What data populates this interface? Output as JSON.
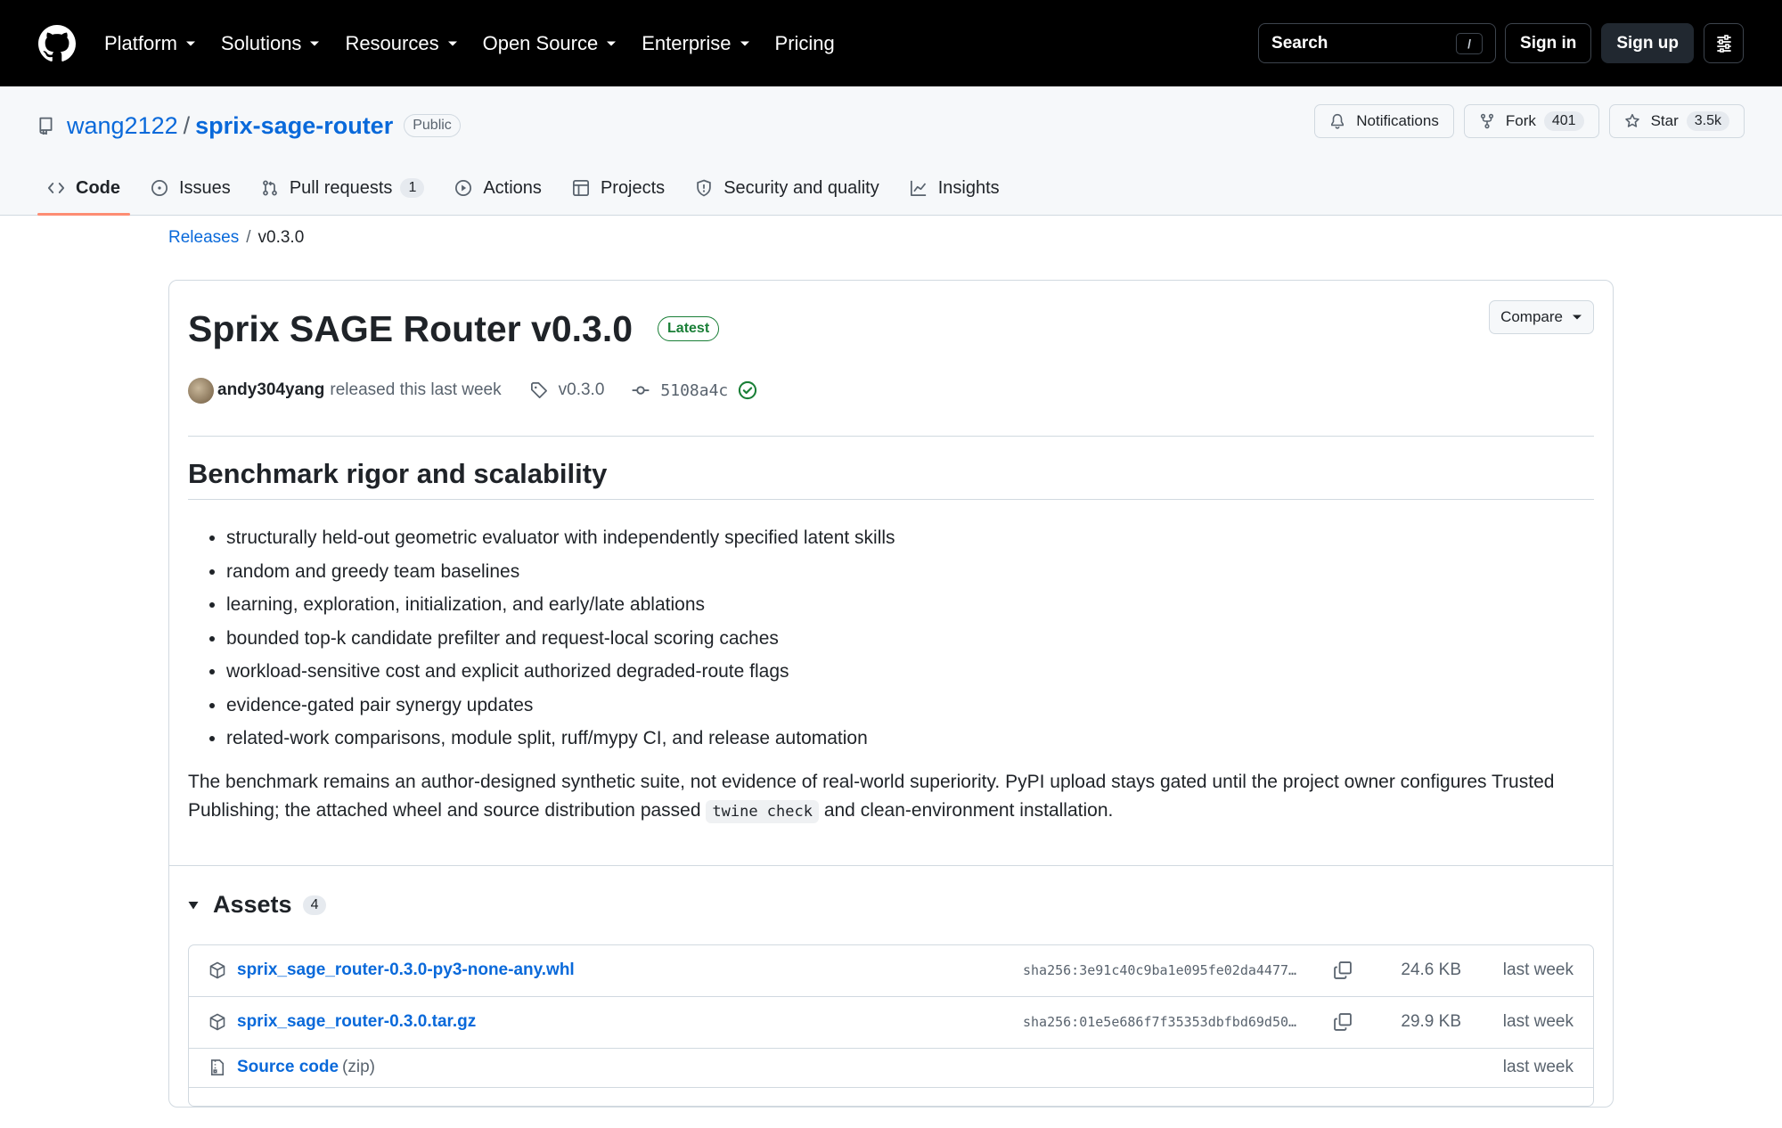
{
  "topnav": {
    "items": [
      "Platform",
      "Solutions",
      "Resources",
      "Open Source",
      "Enterprise"
    ],
    "pricing": "Pricing",
    "search_label": "Search",
    "search_shortcut": "/",
    "sign_in": "Sign in",
    "sign_up": "Sign up"
  },
  "repo": {
    "owner": "wang2122",
    "separator": "/",
    "name": "sprix-sage-router",
    "visibility": "Public",
    "notifications": "Notifications",
    "fork_label": "Fork",
    "fork_count": "401",
    "star_label": "Star",
    "star_count": "3.5k"
  },
  "tabs": [
    {
      "label": "Code",
      "icon": "code-icon"
    },
    {
      "label": "Issues",
      "icon": "issue-icon"
    },
    {
      "label": "Pull requests",
      "icon": "pull-request-icon",
      "count": "1"
    },
    {
      "label": "Actions",
      "icon": "play-icon"
    },
    {
      "label": "Projects",
      "icon": "table-icon"
    },
    {
      "label": "Security and quality",
      "icon": "shield-icon"
    },
    {
      "label": "Insights",
      "icon": "graph-icon"
    }
  ],
  "breadcrumb": {
    "releases": "Releases",
    "sep": "/",
    "current": "v0.3.0"
  },
  "release": {
    "title": "Sprix SAGE Router v0.3.0",
    "badge": "Latest",
    "compare": "Compare",
    "author": "andy304yang",
    "released_text": "released this last week",
    "tag": "v0.3.0",
    "commit": "5108a4c",
    "heading": "Benchmark rigor and scalability",
    "bullets": [
      "structurally held-out geometric evaluator with independently specified latent skills",
      "random and greedy team baselines",
      "learning, exploration, initialization, and early/late ablations",
      "bounded top-k candidate prefilter and request-local scoring caches",
      "workload-sensitive cost and explicit authorized degraded-route flags",
      "evidence-gated pair synergy updates",
      "related-work comparisons, module split, ruff/mypy CI, and release automation"
    ],
    "para_before": "The benchmark remains an author-designed synthetic suite, not evidence of real-world superiority. PyPI upload stays gated until the project owner configures Trusted Publishing; the attached wheel and source distribution passed ",
    "para_code": "twine check",
    "para_after": " and clean-environment installation."
  },
  "assets": {
    "title": "Assets",
    "count": "4",
    "rows": [
      {
        "name": "sprix_sage_router-0.3.0-py3-none-any.whl",
        "sha": "sha256:3e91c40c9ba1e095fe02da4477…",
        "size": "24.6 KB",
        "when": "last week"
      },
      {
        "name": "sprix_sage_router-0.3.0.tar.gz",
        "sha": "sha256:01e5e686f7f35353dbfbd69d50…",
        "size": "29.9 KB",
        "when": "last week"
      }
    ],
    "source_zip": {
      "name": "Source code",
      "suffix": "(zip)",
      "when": "last week"
    }
  }
}
